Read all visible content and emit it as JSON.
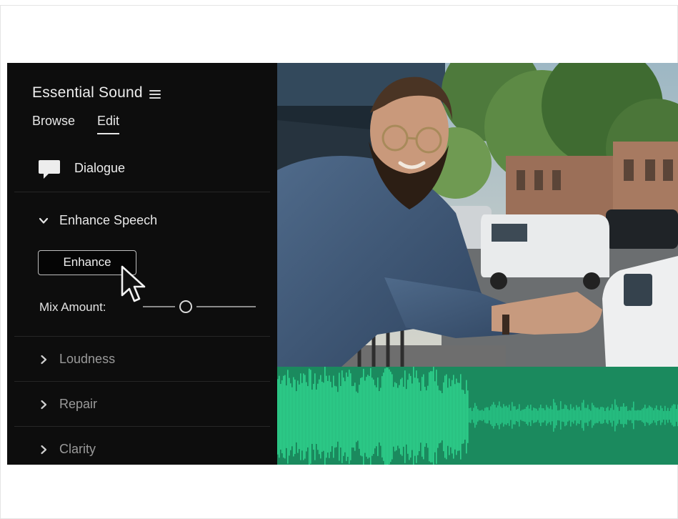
{
  "panel": {
    "title": "Essential Sound",
    "tabs": [
      {
        "label": "Browse",
        "active": false
      },
      {
        "label": "Edit",
        "active": true
      }
    ],
    "clip_type": "Dialogue",
    "enhance_section": {
      "label": "Enhance Speech",
      "expanded": true,
      "button_label": "Enhance",
      "mix_label": "Mix Amount:",
      "mix_level": 0.38
    },
    "collapsed_sections": [
      {
        "label": "Loudness"
      },
      {
        "label": "Repair"
      },
      {
        "label": "Clarity"
      }
    ]
  },
  "icons": {
    "menu": "hamburger-menu-icon",
    "clip_type": "speech-bubble-icon",
    "expanded": "chevron-down-icon",
    "collapsed": "chevron-right-icon",
    "pointer": "mouse-pointer-icon"
  },
  "colors": {
    "panel_bg": "#0d0d0d",
    "waveform_bg": "#1b8a5e",
    "waveform_loud": "#2fd48e",
    "waveform_quiet": "#27c585"
  }
}
